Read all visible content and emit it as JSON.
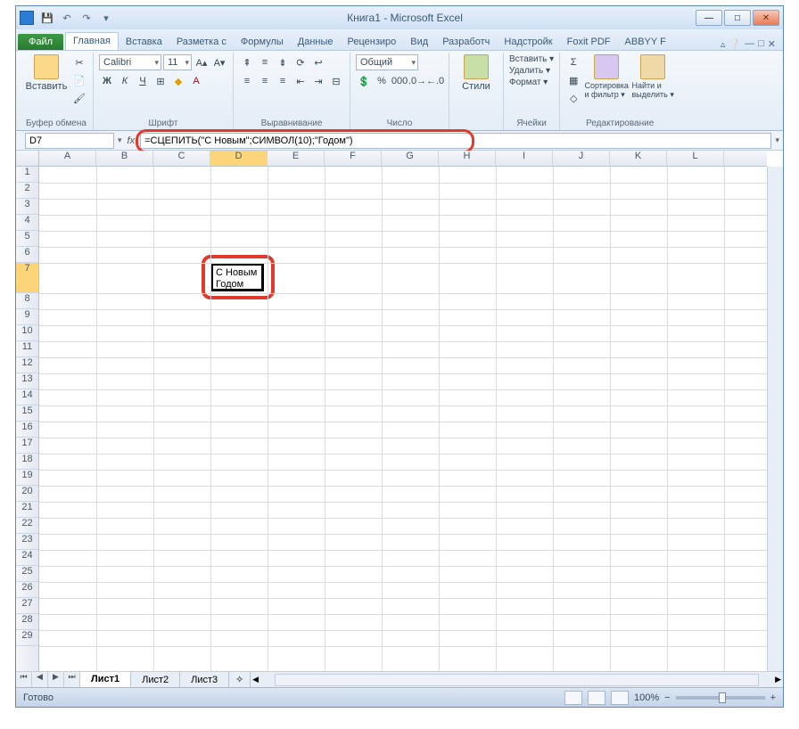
{
  "title": "Книга1  -  Microsoft Excel",
  "qat": {
    "save": "💾",
    "undo": "↶",
    "redo": "↷"
  },
  "winbtns": {
    "min": "—",
    "max": "□",
    "close": "✕"
  },
  "file_label": "Файл",
  "tabs": [
    "Главная",
    "Вставка",
    "Разметка с",
    "Формулы",
    "Данные",
    "Рецензиро",
    "Вид",
    "Разработч",
    "Надстройк",
    "Foxit PDF",
    "ABBYY F"
  ],
  "ribbon": {
    "clipboard": {
      "paste": "Вставить",
      "label": "Буфер обмена"
    },
    "font": {
      "name": "Calibri",
      "size": "11",
      "label": "Шрифт",
      "bold": "Ж",
      "italic": "К",
      "underline": "Ч",
      "border": "⊞",
      "fill": "◆",
      "color": "A"
    },
    "align": {
      "label": "Выравнивание"
    },
    "number": {
      "format": "Общий",
      "label": "Число"
    },
    "styles": {
      "btn": "Стили",
      "label": ""
    },
    "cells": {
      "insert": "Вставить ▾",
      "delete": "Удалить ▾",
      "format": "Формат ▾",
      "label": "Ячейки"
    },
    "editing": {
      "sort": "Сортировка\nи фильтр ▾",
      "find": "Найти и\nвыделить ▾",
      "label": "Редактирование",
      "sigma": "Σ"
    }
  },
  "namebox": "D7",
  "formula": "=СЦЕПИТЬ(\"С Новым\";СИМВОЛ(10);\"Годом\")",
  "fx": "fx",
  "columns": [
    "A",
    "B",
    "C",
    "D",
    "E",
    "F",
    "G",
    "H",
    "I",
    "J",
    "K",
    "L"
  ],
  "rows": [
    "1",
    "2",
    "3",
    "4",
    "5",
    "6",
    "7",
    "8",
    "9",
    "10",
    "11",
    "12",
    "13",
    "14",
    "15",
    "16",
    "17",
    "18",
    "19",
    "20",
    "21",
    "22",
    "23",
    "24",
    "25",
    "26",
    "27",
    "28",
    "29"
  ],
  "cell_d7": "С Новым\nГодом",
  "sheets": [
    "Лист1",
    "Лист2",
    "Лист3"
  ],
  "sheet_nav": [
    "⏮",
    "◀",
    "▶",
    "⏭"
  ],
  "status": "Готово",
  "zoom": "100%",
  "zoom_minus": "−",
  "zoom_plus": "+"
}
